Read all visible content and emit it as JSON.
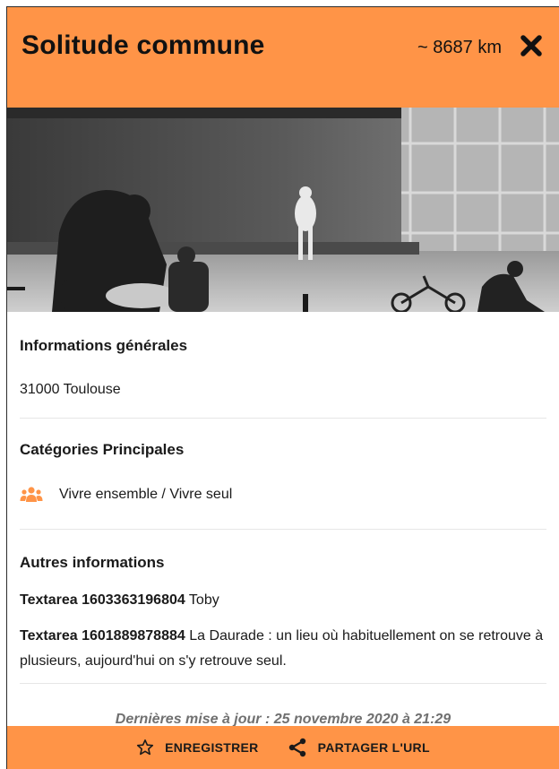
{
  "header": {
    "title": "Solitude commune",
    "distance": "~ 8687 km",
    "close_icon": "close-icon",
    "background_color": "#ff9447"
  },
  "photo": {
    "style": "black-and-white"
  },
  "general": {
    "heading": "Informations générales",
    "address": "31000 Toulouse"
  },
  "categories": {
    "heading": "Catégories Principales",
    "items": [
      {
        "icon": "group-icon",
        "label": "Vivre ensemble / Vivre seul"
      }
    ]
  },
  "other": {
    "heading": "Autres informations",
    "rows": [
      {
        "key": "Textarea 1603363196804",
        "value": "Toby"
      },
      {
        "key": "Textarea 1601889878884",
        "value": "La Daurade : un lieu où habituellement on se retrouve à plusieurs, aujourd'hui on s'y retrouve seul."
      }
    ]
  },
  "updated": "Dernières mise à jour : 25 novembre 2020 à 21:29",
  "footer": {
    "save_label": "ENREGISTRER",
    "save_icon": "star-icon",
    "share_label": "PARTAGER L'URL",
    "share_icon": "share-icon",
    "background_color": "#ff9447"
  },
  "colors": {
    "accent": "#ff9447",
    "muted_text": "#707070"
  }
}
